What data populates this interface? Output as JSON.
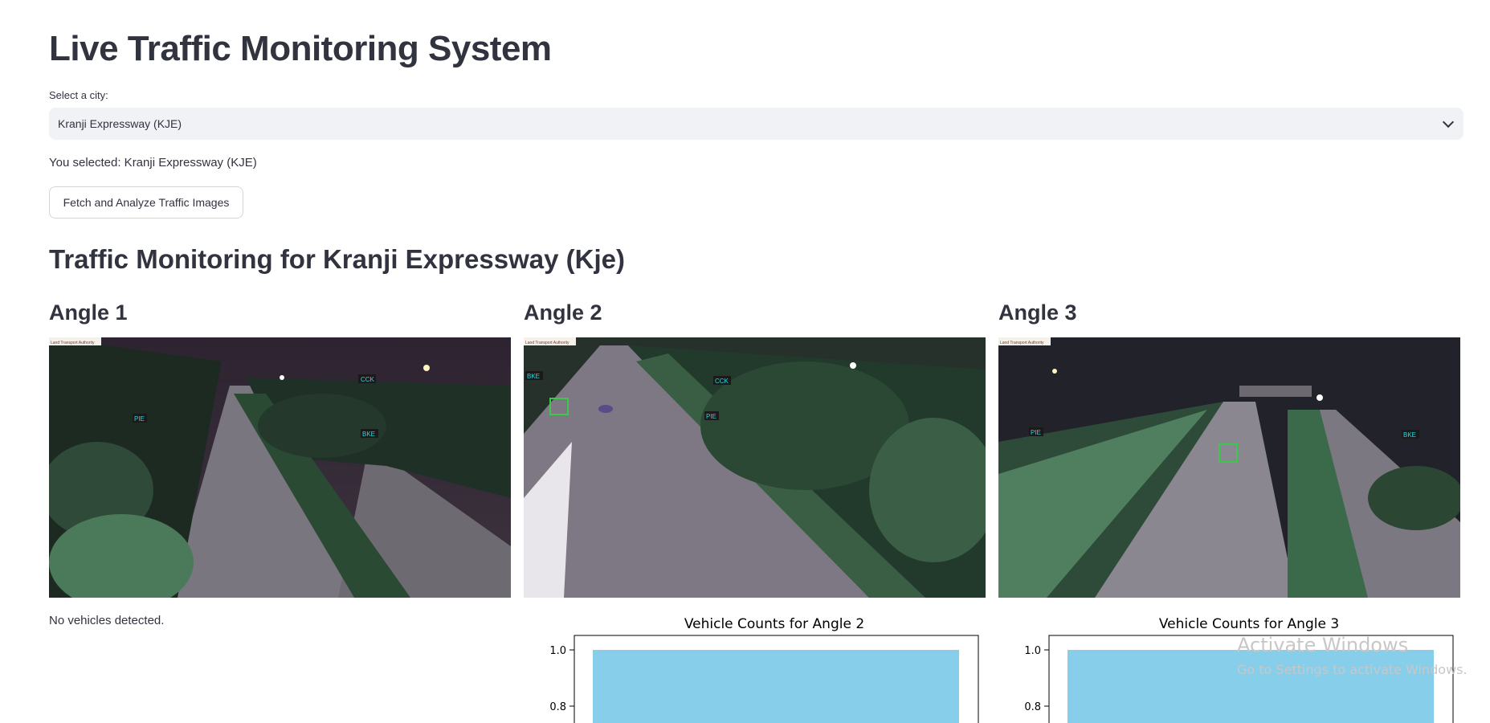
{
  "title": "Live Traffic Monitoring System",
  "select": {
    "label": "Select a city:",
    "value": "Kranji Expressway (KJE)",
    "icon": "chevron-down-icon"
  },
  "selected_text": "You selected: Kranji Expressway (KJE)",
  "fetch_button": "Fetch and Analyze Traffic Images",
  "section_title": "Traffic Monitoring for Kranji Expressway (Kje)",
  "camera_logo_text": "Land Transport Authority",
  "angles": [
    {
      "title": "Angle 1",
      "overlay_labels": [
        "CCK",
        "PIE",
        "BKE"
      ],
      "status": "No vehicles detected."
    },
    {
      "title": "Angle 2",
      "overlay_labels": [
        "BKE",
        "CCK",
        "PIE"
      ]
    },
    {
      "title": "Angle 3",
      "overlay_labels": [
        "PIE",
        "BKE"
      ]
    }
  ],
  "chart_data": [
    {
      "type": "bar",
      "title": "Vehicle Counts for Angle 2",
      "categories": [],
      "values": [
        1.0
      ],
      "yticks": [
        "1.0",
        "0.8"
      ],
      "color": "#87ceeb"
    },
    {
      "type": "bar",
      "title": "Vehicle Counts for Angle 3",
      "categories": [],
      "values": [
        1.0
      ],
      "yticks": [
        "1.0",
        "0.8"
      ],
      "color": "#87ceeb"
    }
  ],
  "watermark": {
    "line1": "Activate Windows",
    "line2": "Go to Settings to activate Windows."
  },
  "colors": {
    "text": "#31333f",
    "select_bg": "#f0f2f6",
    "overlay_label_bg": "#1a1a1a",
    "overlay_label_text": "#2fd8e0"
  }
}
